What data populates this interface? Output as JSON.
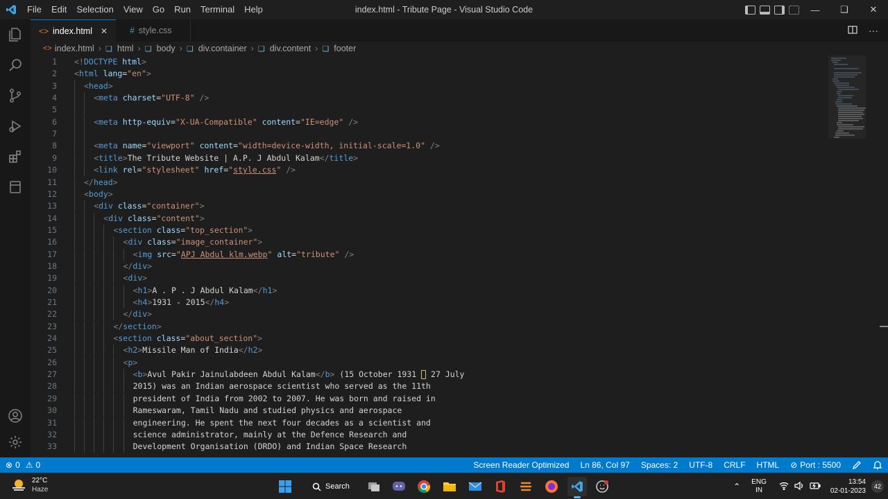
{
  "window": {
    "title": "index.html - Tribute Page - Visual Studio Code",
    "menu": [
      "File",
      "Edit",
      "Selection",
      "View",
      "Go",
      "Run",
      "Terminal",
      "Help"
    ]
  },
  "tabs": [
    {
      "label": "index.html",
      "icon": "html-file-icon",
      "active": true,
      "close": "✕"
    },
    {
      "label": "style.css",
      "icon": "css-file-icon",
      "active": false
    }
  ],
  "breadcrumb": [
    "index.html",
    "html",
    "body",
    "div.container",
    "div.content",
    "footer"
  ],
  "editor": {
    "lines": [
      {
        "n": "1",
        "indent": 0,
        "t": [
          [
            "t",
            "<!"
          ],
          [
            "n",
            "DOCTYPE "
          ],
          [
            "a",
            "html"
          ],
          [
            "t",
            ">"
          ]
        ]
      },
      {
        "n": "2",
        "indent": 0,
        "t": [
          [
            "t",
            "<"
          ],
          [
            "n",
            "html "
          ],
          [
            "a",
            "lang"
          ],
          [
            "x",
            "="
          ],
          [
            "s",
            "\"en\""
          ],
          [
            "t",
            ">"
          ]
        ]
      },
      {
        "n": "3",
        "indent": 1,
        "t": [
          [
            "t",
            "<"
          ],
          [
            "n",
            "head"
          ],
          [
            "t",
            ">"
          ]
        ]
      },
      {
        "n": "4",
        "indent": 2,
        "t": [
          [
            "t",
            "<"
          ],
          [
            "n",
            "meta "
          ],
          [
            "a",
            "charset"
          ],
          [
            "x",
            "="
          ],
          [
            "s",
            "\"UTF-8\""
          ],
          [
            "t",
            " />"
          ]
        ]
      },
      {
        "n": "5",
        "indent": 2,
        "t": []
      },
      {
        "n": "6",
        "indent": 2,
        "t": [
          [
            "t",
            "<"
          ],
          [
            "n",
            "meta "
          ],
          [
            "a",
            "http-equiv"
          ],
          [
            "x",
            "="
          ],
          [
            "s",
            "\"X-UA-Compatible\""
          ],
          [
            "x",
            " "
          ],
          [
            "a",
            "content"
          ],
          [
            "x",
            "="
          ],
          [
            "s",
            "\"IE=edge\""
          ],
          [
            "t",
            " />"
          ]
        ]
      },
      {
        "n": "7",
        "indent": 2,
        "t": []
      },
      {
        "n": "8",
        "indent": 2,
        "t": [
          [
            "t",
            "<"
          ],
          [
            "n",
            "meta "
          ],
          [
            "a",
            "name"
          ],
          [
            "x",
            "="
          ],
          [
            "s",
            "\"viewport\""
          ],
          [
            "x",
            " "
          ],
          [
            "a",
            "content"
          ],
          [
            "x",
            "="
          ],
          [
            "s",
            "\"width=device-width, initial-scale=1.0\""
          ],
          [
            "t",
            " />"
          ]
        ]
      },
      {
        "n": "9",
        "indent": 2,
        "t": [
          [
            "t",
            "<"
          ],
          [
            "n",
            "title"
          ],
          [
            "t",
            ">"
          ],
          [
            "x",
            "The Tribute Website | A.P. J Abdul Kalam"
          ],
          [
            "t",
            "</"
          ],
          [
            "n",
            "title"
          ],
          [
            "t",
            ">"
          ]
        ]
      },
      {
        "n": "10",
        "indent": 2,
        "t": [
          [
            "t",
            "<"
          ],
          [
            "n",
            "link "
          ],
          [
            "a",
            "rel"
          ],
          [
            "x",
            "="
          ],
          [
            "s",
            "\"stylesheet\""
          ],
          [
            "x",
            " "
          ],
          [
            "a",
            "href"
          ],
          [
            "x",
            "="
          ],
          [
            "s",
            "\""
          ],
          [
            "su",
            "style.css"
          ],
          [
            "s",
            "\""
          ],
          [
            "t",
            " />"
          ]
        ]
      },
      {
        "n": "11",
        "indent": 1,
        "t": [
          [
            "t",
            "</"
          ],
          [
            "n",
            "head"
          ],
          [
            "t",
            ">"
          ]
        ]
      },
      {
        "n": "12",
        "indent": 1,
        "t": [
          [
            "t",
            "<"
          ],
          [
            "n",
            "body"
          ],
          [
            "t",
            ">"
          ]
        ]
      },
      {
        "n": "13",
        "indent": 2,
        "t": [
          [
            "t",
            "<"
          ],
          [
            "n",
            "div "
          ],
          [
            "a",
            "class"
          ],
          [
            "x",
            "="
          ],
          [
            "s",
            "\"container\""
          ],
          [
            "t",
            ">"
          ]
        ]
      },
      {
        "n": "14",
        "indent": 3,
        "t": [
          [
            "t",
            "<"
          ],
          [
            "n",
            "div "
          ],
          [
            "a",
            "class"
          ],
          [
            "x",
            "="
          ],
          [
            "s",
            "\"content\""
          ],
          [
            "t",
            ">"
          ]
        ]
      },
      {
        "n": "15",
        "indent": 4,
        "t": [
          [
            "t",
            "<"
          ],
          [
            "n",
            "section "
          ],
          [
            "a",
            "class"
          ],
          [
            "x",
            "="
          ],
          [
            "s",
            "\"top_section\""
          ],
          [
            "t",
            ">"
          ]
        ]
      },
      {
        "n": "16",
        "indent": 5,
        "t": [
          [
            "t",
            "<"
          ],
          [
            "n",
            "div "
          ],
          [
            "a",
            "class"
          ],
          [
            "x",
            "="
          ],
          [
            "s",
            "\"image_container\""
          ],
          [
            "t",
            ">"
          ]
        ]
      },
      {
        "n": "17",
        "indent": 6,
        "t": [
          [
            "t",
            "<"
          ],
          [
            "n",
            "img "
          ],
          [
            "a",
            "src"
          ],
          [
            "x",
            "="
          ],
          [
            "s",
            "\""
          ],
          [
            "su",
            "APJ Abdul klm.webp"
          ],
          [
            "s",
            "\""
          ],
          [
            "x",
            " "
          ],
          [
            "a",
            "alt"
          ],
          [
            "x",
            "="
          ],
          [
            "s",
            "\"tribute\""
          ],
          [
            "t",
            " />"
          ]
        ]
      },
      {
        "n": "18",
        "indent": 5,
        "t": [
          [
            "t",
            "</"
          ],
          [
            "n",
            "div"
          ],
          [
            "t",
            ">"
          ]
        ]
      },
      {
        "n": "19",
        "indent": 5,
        "t": [
          [
            "t",
            "<"
          ],
          [
            "n",
            "div"
          ],
          [
            "t",
            ">"
          ]
        ]
      },
      {
        "n": "20",
        "indent": 6,
        "t": [
          [
            "t",
            "<"
          ],
          [
            "n",
            "h1"
          ],
          [
            "t",
            ">"
          ],
          [
            "x",
            "A . P . J Abdul Kalam"
          ],
          [
            "t",
            "</"
          ],
          [
            "n",
            "h1"
          ],
          [
            "t",
            ">"
          ]
        ]
      },
      {
        "n": "21",
        "indent": 6,
        "t": [
          [
            "t",
            "<"
          ],
          [
            "n",
            "h4"
          ],
          [
            "t",
            ">"
          ],
          [
            "x",
            "1931 - 2015"
          ],
          [
            "t",
            "</"
          ],
          [
            "n",
            "h4"
          ],
          [
            "t",
            ">"
          ]
        ]
      },
      {
        "n": "22",
        "indent": 5,
        "t": [
          [
            "t",
            "</"
          ],
          [
            "n",
            "div"
          ],
          [
            "t",
            ">"
          ]
        ]
      },
      {
        "n": "23",
        "indent": 4,
        "t": [
          [
            "t",
            "</"
          ],
          [
            "n",
            "section"
          ],
          [
            "t",
            ">"
          ]
        ]
      },
      {
        "n": "24",
        "indent": 4,
        "t": [
          [
            "t",
            "<"
          ],
          [
            "n",
            "section "
          ],
          [
            "a",
            "class"
          ],
          [
            "x",
            "="
          ],
          [
            "s",
            "\"about_section\""
          ],
          [
            "t",
            ">"
          ]
        ]
      },
      {
        "n": "25",
        "indent": 5,
        "t": [
          [
            "t",
            "<"
          ],
          [
            "n",
            "h2"
          ],
          [
            "t",
            ">"
          ],
          [
            "x",
            "Missile Man of India"
          ],
          [
            "t",
            "</"
          ],
          [
            "n",
            "h2"
          ],
          [
            "t",
            ">"
          ]
        ]
      },
      {
        "n": "26",
        "indent": 5,
        "t": [
          [
            "t",
            "<"
          ],
          [
            "n",
            "p"
          ],
          [
            "t",
            ">"
          ]
        ]
      },
      {
        "n": "27",
        "indent": 6,
        "t": [
          [
            "t",
            "<"
          ],
          [
            "n",
            "b"
          ],
          [
            "t",
            ">"
          ],
          [
            "x",
            "Avul Pakir Jainulabdeen Abdul Kalam"
          ],
          [
            "t",
            "</"
          ],
          [
            "n",
            "b"
          ],
          [
            "t",
            ">"
          ],
          [
            "x",
            " (15 October 1931 "
          ],
          [
            "w",
            ""
          ],
          [
            "x",
            " 27 July"
          ]
        ]
      },
      {
        "n": "28",
        "indent": 6,
        "t": [
          [
            "x",
            "2015) was an Indian aerospace scientist who served as the 11th"
          ]
        ]
      },
      {
        "n": "29",
        "indent": 6,
        "t": [
          [
            "x",
            "president of India from 2002 to 2007. He was born and raised in"
          ]
        ]
      },
      {
        "n": "30",
        "indent": 6,
        "t": [
          [
            "x",
            "Rameswaram, Tamil Nadu and studied physics and aerospace"
          ]
        ]
      },
      {
        "n": "31",
        "indent": 6,
        "t": [
          [
            "x",
            "engineering. He spent the next four decades as a scientist and"
          ]
        ]
      },
      {
        "n": "32",
        "indent": 6,
        "t": [
          [
            "x",
            "science administrator, mainly at the Defence Research and"
          ]
        ]
      },
      {
        "n": "33",
        "indent": 6,
        "t": [
          [
            "x",
            "Development Organisation (DRDO) and Indian Space Research"
          ]
        ]
      }
    ]
  },
  "statusbar": {
    "errors": "0",
    "warnings": "0",
    "screen_reader": "Screen Reader Optimized",
    "position": "Ln 86, Col 97",
    "spaces": "Spaces: 2",
    "encoding": "UTF-8",
    "eol": "CRLF",
    "language": "HTML",
    "port": "Port : 5500"
  },
  "taskbar": {
    "weather_temp": "22°C",
    "weather_desc": "Haze",
    "search_label": "Search",
    "lang_top": "ENG",
    "lang_bottom": "IN",
    "time": "13:54",
    "date": "02-01-2023",
    "notifications": "42"
  },
  "colors": {
    "accent": "#007acc",
    "tag_bracket": "#808080",
    "tag_name": "#569cd6",
    "attr": "#9cdcfe",
    "string": "#ce9178"
  }
}
